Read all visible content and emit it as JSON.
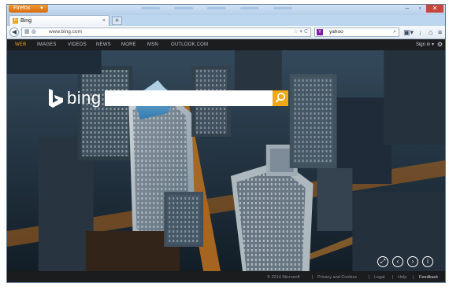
{
  "browser": {
    "menu_button_label": "Firefox",
    "tab": {
      "title": "Bing"
    },
    "address_bar": {
      "url": "www.bing.com"
    },
    "search_bar": {
      "engine": "yahoo",
      "query": "yahoo"
    }
  },
  "bing": {
    "logo_text": "bing",
    "nav_items": [
      "WEB",
      "IMAGES",
      "VIDEOS",
      "NEWS",
      "MORE",
      "MSN",
      "OUTLOOK.COM"
    ],
    "active_nav": "WEB",
    "sign_in_label": "Sign in",
    "search": {
      "value": "",
      "placeholder": ""
    },
    "footer": {
      "copyright": "© 2014 Microsoft",
      "links": [
        "Privacy and Cookies",
        "Legal",
        "Help",
        "Feedback"
      ]
    }
  },
  "colors": {
    "bing_accent": "#f2a714",
    "firefox_orange": "#e87d12",
    "window_frame": "#bcd6ef"
  }
}
